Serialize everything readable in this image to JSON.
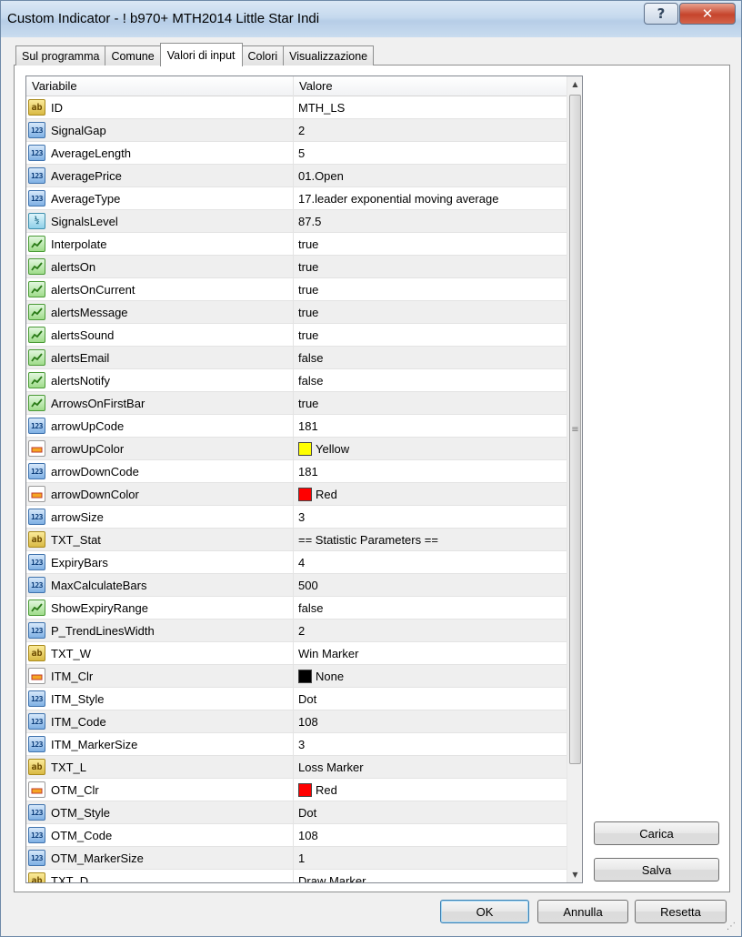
{
  "window": {
    "title": "Custom Indicator - !   b970+ MTH2014 Little Star Indi",
    "help_label": "?",
    "close_label": "✕"
  },
  "tabs": [
    {
      "label": "Sul programma",
      "active": false
    },
    {
      "label": "Comune",
      "active": false
    },
    {
      "label": "Valori di input",
      "active": true
    },
    {
      "label": "Colori",
      "active": false
    },
    {
      "label": "Visualizzazione",
      "active": false
    }
  ],
  "grid": {
    "columns": [
      "Variabile",
      "Valore"
    ],
    "rows": [
      {
        "icon": "string-icon",
        "type": "str",
        "name": "ID",
        "value": "MTH_LS"
      },
      {
        "icon": "integer-icon",
        "type": "int",
        "name": "SignalGap",
        "value": "2"
      },
      {
        "icon": "integer-icon",
        "type": "int",
        "name": "AverageLength",
        "value": "5"
      },
      {
        "icon": "integer-icon",
        "type": "int",
        "name": "AveragePrice",
        "value": "01.Open"
      },
      {
        "icon": "integer-icon",
        "type": "int",
        "name": "AverageType",
        "value": "17.leader exponential moving average"
      },
      {
        "icon": "double-icon",
        "type": "dbl",
        "name": "SignalsLevel",
        "value": "87.5"
      },
      {
        "icon": "bool-icon",
        "type": "bool",
        "name": "Interpolate",
        "value": "true"
      },
      {
        "icon": "bool-icon",
        "type": "bool",
        "name": "alertsOn",
        "value": "true"
      },
      {
        "icon": "bool-icon",
        "type": "bool",
        "name": "alertsOnCurrent",
        "value": "true"
      },
      {
        "icon": "bool-icon",
        "type": "bool",
        "name": "alertsMessage",
        "value": "true"
      },
      {
        "icon": "bool-icon",
        "type": "bool",
        "name": "alertsSound",
        "value": "true"
      },
      {
        "icon": "bool-icon",
        "type": "bool",
        "name": "alertsEmail",
        "value": "false"
      },
      {
        "icon": "bool-icon",
        "type": "bool",
        "name": "alertsNotify",
        "value": "false"
      },
      {
        "icon": "bool-icon",
        "type": "bool",
        "name": "ArrowsOnFirstBar",
        "value": "true"
      },
      {
        "icon": "integer-icon",
        "type": "int",
        "name": "arrowUpCode",
        "value": "181"
      },
      {
        "icon": "color-icon",
        "type": "clr",
        "name": "arrowUpColor",
        "value": "Yellow",
        "swatch": "#ffff00"
      },
      {
        "icon": "integer-icon",
        "type": "int",
        "name": "arrowDownCode",
        "value": "181"
      },
      {
        "icon": "color-icon",
        "type": "clr",
        "name": "arrowDownColor",
        "value": "Red",
        "swatch": "#ff0000"
      },
      {
        "icon": "integer-icon",
        "type": "int",
        "name": "arrowSize",
        "value": "3"
      },
      {
        "icon": "string-icon",
        "type": "str",
        "name": "TXT_Stat",
        "value": "== Statistic Parameters =="
      },
      {
        "icon": "integer-icon",
        "type": "int",
        "name": "ExpiryBars",
        "value": "4"
      },
      {
        "icon": "integer-icon",
        "type": "int",
        "name": "MaxCalculateBars",
        "value": "500"
      },
      {
        "icon": "bool-icon",
        "type": "bool",
        "name": "ShowExpiryRange",
        "value": "false"
      },
      {
        "icon": "integer-icon",
        "type": "int",
        "name": "P_TrendLinesWidth",
        "value": "2"
      },
      {
        "icon": "string-icon",
        "type": "str",
        "name": "TXT_W",
        "value": "Win Marker"
      },
      {
        "icon": "color-icon",
        "type": "clr",
        "name": "ITM_Clr",
        "value": "None",
        "swatch": "#000000"
      },
      {
        "icon": "integer-icon",
        "type": "int",
        "name": "ITM_Style",
        "value": "Dot"
      },
      {
        "icon": "integer-icon",
        "type": "int",
        "name": "ITM_Code",
        "value": "108"
      },
      {
        "icon": "integer-icon",
        "type": "int",
        "name": "ITM_MarkerSize",
        "value": "3"
      },
      {
        "icon": "string-icon",
        "type": "str",
        "name": "TXT_L",
        "value": "Loss Marker"
      },
      {
        "icon": "color-icon",
        "type": "clr",
        "name": "OTM_Clr",
        "value": "Red",
        "swatch": "#ff0000"
      },
      {
        "icon": "integer-icon",
        "type": "int",
        "name": "OTM_Style",
        "value": "Dot"
      },
      {
        "icon": "integer-icon",
        "type": "int",
        "name": "OTM_Code",
        "value": "108"
      },
      {
        "icon": "integer-icon",
        "type": "int",
        "name": "OTM_MarkerSize",
        "value": "1"
      },
      {
        "icon": "string-icon",
        "type": "str",
        "name": "TXT_D",
        "value": "Draw Marker"
      }
    ]
  },
  "icon_glyphs": {
    "str": "ab",
    "int": "123",
    "dbl": "½",
    "bool": "",
    "clr": ""
  },
  "side_buttons": {
    "load_label": "Carica",
    "save_label": "Salva"
  },
  "footer_buttons": {
    "ok_label": "OK",
    "cancel_label": "Annulla",
    "reset_label": "Resetta"
  }
}
